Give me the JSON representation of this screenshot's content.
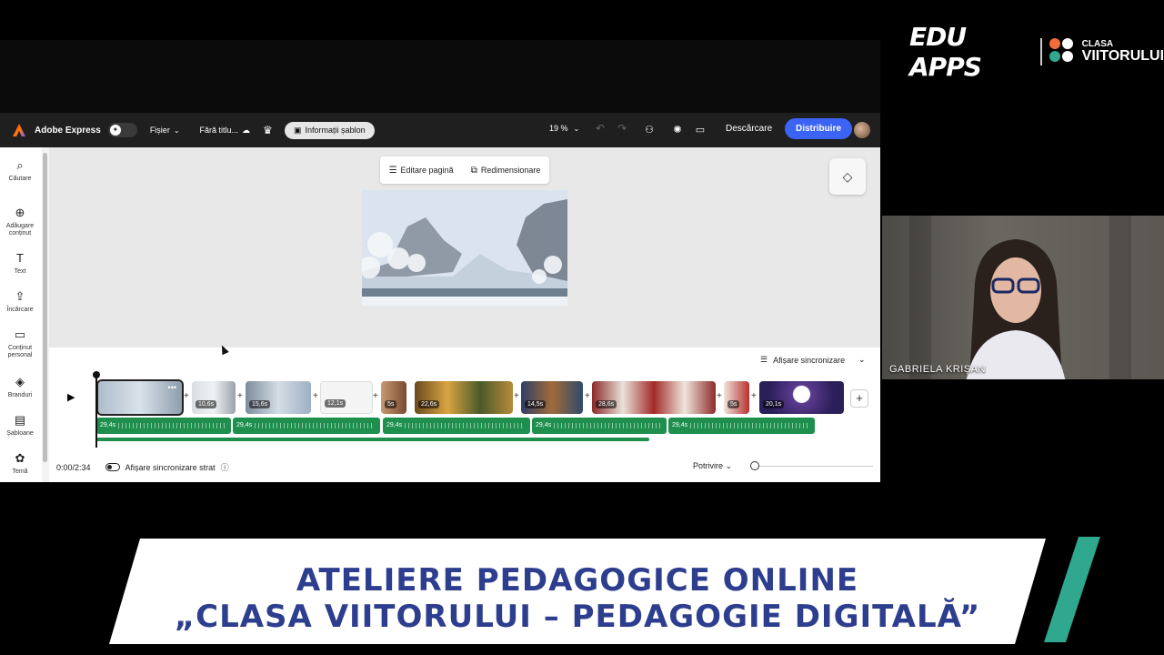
{
  "brand": {
    "edu_apps": "EDU APPS",
    "clasa_small": "CLASA",
    "clasa_big": "VIITORULUI"
  },
  "topbar": {
    "app_name": "Adobe Express",
    "file_menu": "Fișier",
    "doc_title": "Fără titlu...",
    "info_button": "Informații șablon",
    "zoom": "19 %",
    "download": "Descărcare",
    "share": "Distribuire"
  },
  "sidebar": {
    "items": [
      {
        "label": "Căutare",
        "icon": "search-icon"
      },
      {
        "label": "Adăugare conținut",
        "icon": "add-icon"
      },
      {
        "label": "Text",
        "icon": "text-icon"
      },
      {
        "label": "Încărcare",
        "icon": "upload-icon"
      },
      {
        "label": "Conținut personal",
        "icon": "folder-icon"
      },
      {
        "label": "Branduri",
        "icon": "brand-icon"
      },
      {
        "label": "Șabloane",
        "icon": "template-icon"
      },
      {
        "label": "Temă",
        "icon": "theme-icon"
      }
    ]
  },
  "canvas": {
    "edit_page": "Editare pagină",
    "resize": "Redimensionare"
  },
  "timeline": {
    "sync_view": "Afișare sincronizare",
    "clips": [
      "10,6s",
      "15,6s",
      "12,1s",
      "5s",
      "22,6s",
      "14,5s",
      "28,6s",
      "5s",
      "20,1s"
    ],
    "audio": [
      "29,4s",
      "29,4s",
      "29,4s",
      "29,4s",
      "29,4s"
    ],
    "time": "0:00/2:34",
    "layer_sync": "Afișare sincronizare strat",
    "fit": "Potrivire",
    "progress": 0.74
  },
  "webcam": {
    "name": "GABRIELA KRIȘAN"
  },
  "banner": {
    "line1": "ATELIERE PEDAGOGICE ONLINE",
    "line2": "„CLASA VIITORULUI – PEDAGOGIE DIGITALĂ”"
  },
  "colors": {
    "accent": "#3b63f4",
    "audio_green": "#1e8f4d",
    "banner_blue": "#2d3e8f",
    "stripe_teal": "#2fa88f"
  }
}
